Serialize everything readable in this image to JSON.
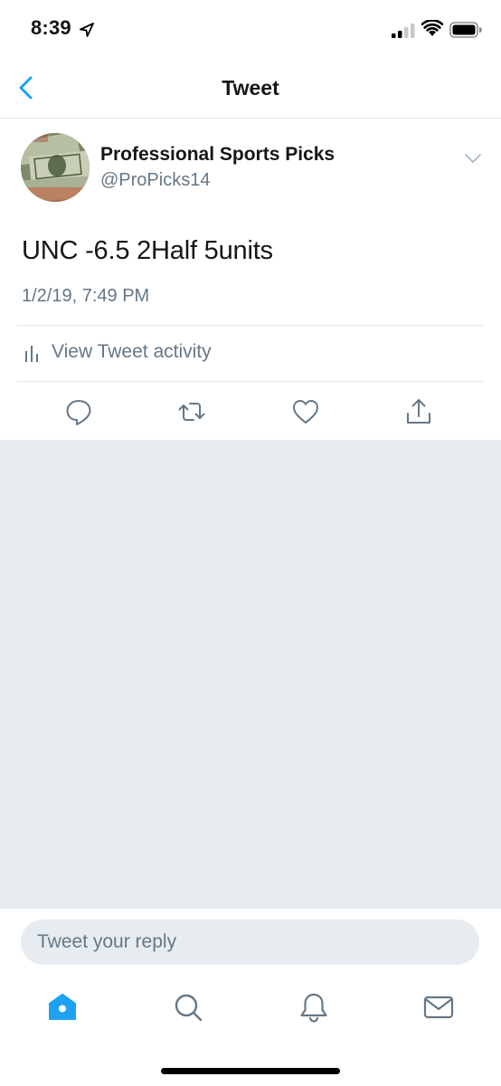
{
  "status_bar": {
    "time": "8:39"
  },
  "nav": {
    "title": "Tweet",
    "back_icon": "chevron-left-icon"
  },
  "tweet": {
    "author_name": "Professional Sports Picks",
    "author_handle": "@ProPicks14",
    "text": "UNC -6.5 2Half 5units",
    "timestamp": "1/2/19, 7:49 PM",
    "activity_label": "View Tweet activity"
  },
  "actions": [
    "reply-icon",
    "retweet-icon",
    "like-icon",
    "share-icon"
  ],
  "reply": {
    "placeholder": "Tweet your reply"
  },
  "tabs": [
    "home-icon",
    "search-icon",
    "notifications-icon",
    "messages-icon"
  ],
  "colors": {
    "accent": "#1da1f2",
    "secondary_text": "#657786",
    "background_gray": "#e6ecf0"
  }
}
